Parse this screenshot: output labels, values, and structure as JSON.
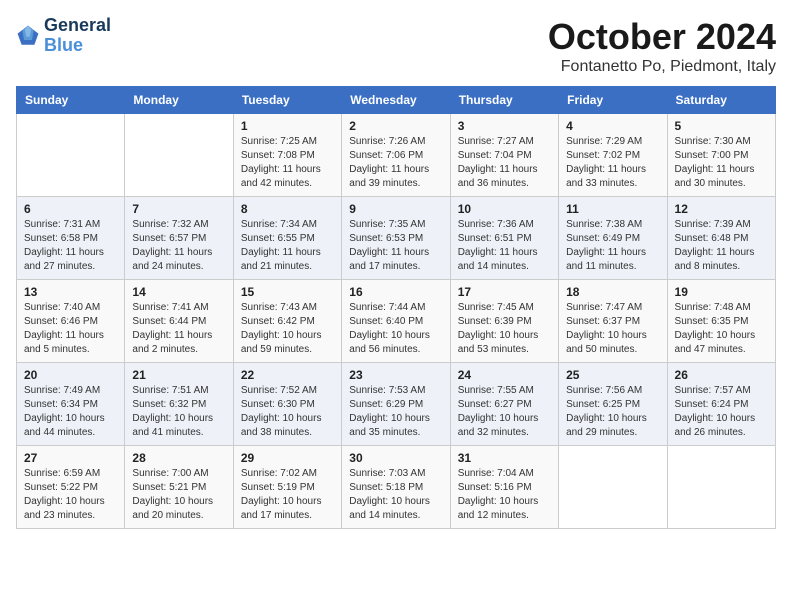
{
  "header": {
    "logo_line1": "General",
    "logo_line2": "Blue",
    "month": "October 2024",
    "location": "Fontanetto Po, Piedmont, Italy"
  },
  "weekdays": [
    "Sunday",
    "Monday",
    "Tuesday",
    "Wednesday",
    "Thursday",
    "Friday",
    "Saturday"
  ],
  "weeks": [
    [
      {
        "day": "",
        "sunrise": "",
        "sunset": "",
        "daylight": ""
      },
      {
        "day": "",
        "sunrise": "",
        "sunset": "",
        "daylight": ""
      },
      {
        "day": "1",
        "sunrise": "Sunrise: 7:25 AM",
        "sunset": "Sunset: 7:08 PM",
        "daylight": "Daylight: 11 hours and 42 minutes."
      },
      {
        "day": "2",
        "sunrise": "Sunrise: 7:26 AM",
        "sunset": "Sunset: 7:06 PM",
        "daylight": "Daylight: 11 hours and 39 minutes."
      },
      {
        "day": "3",
        "sunrise": "Sunrise: 7:27 AM",
        "sunset": "Sunset: 7:04 PM",
        "daylight": "Daylight: 11 hours and 36 minutes."
      },
      {
        "day": "4",
        "sunrise": "Sunrise: 7:29 AM",
        "sunset": "Sunset: 7:02 PM",
        "daylight": "Daylight: 11 hours and 33 minutes."
      },
      {
        "day": "5",
        "sunrise": "Sunrise: 7:30 AM",
        "sunset": "Sunset: 7:00 PM",
        "daylight": "Daylight: 11 hours and 30 minutes."
      }
    ],
    [
      {
        "day": "6",
        "sunrise": "Sunrise: 7:31 AM",
        "sunset": "Sunset: 6:58 PM",
        "daylight": "Daylight: 11 hours and 27 minutes."
      },
      {
        "day": "7",
        "sunrise": "Sunrise: 7:32 AM",
        "sunset": "Sunset: 6:57 PM",
        "daylight": "Daylight: 11 hours and 24 minutes."
      },
      {
        "day": "8",
        "sunrise": "Sunrise: 7:34 AM",
        "sunset": "Sunset: 6:55 PM",
        "daylight": "Daylight: 11 hours and 21 minutes."
      },
      {
        "day": "9",
        "sunrise": "Sunrise: 7:35 AM",
        "sunset": "Sunset: 6:53 PM",
        "daylight": "Daylight: 11 hours and 17 minutes."
      },
      {
        "day": "10",
        "sunrise": "Sunrise: 7:36 AM",
        "sunset": "Sunset: 6:51 PM",
        "daylight": "Daylight: 11 hours and 14 minutes."
      },
      {
        "day": "11",
        "sunrise": "Sunrise: 7:38 AM",
        "sunset": "Sunset: 6:49 PM",
        "daylight": "Daylight: 11 hours and 11 minutes."
      },
      {
        "day": "12",
        "sunrise": "Sunrise: 7:39 AM",
        "sunset": "Sunset: 6:48 PM",
        "daylight": "Daylight: 11 hours and 8 minutes."
      }
    ],
    [
      {
        "day": "13",
        "sunrise": "Sunrise: 7:40 AM",
        "sunset": "Sunset: 6:46 PM",
        "daylight": "Daylight: 11 hours and 5 minutes."
      },
      {
        "day": "14",
        "sunrise": "Sunrise: 7:41 AM",
        "sunset": "Sunset: 6:44 PM",
        "daylight": "Daylight: 11 hours and 2 minutes."
      },
      {
        "day": "15",
        "sunrise": "Sunrise: 7:43 AM",
        "sunset": "Sunset: 6:42 PM",
        "daylight": "Daylight: 10 hours and 59 minutes."
      },
      {
        "day": "16",
        "sunrise": "Sunrise: 7:44 AM",
        "sunset": "Sunset: 6:40 PM",
        "daylight": "Daylight: 10 hours and 56 minutes."
      },
      {
        "day": "17",
        "sunrise": "Sunrise: 7:45 AM",
        "sunset": "Sunset: 6:39 PM",
        "daylight": "Daylight: 10 hours and 53 minutes."
      },
      {
        "day": "18",
        "sunrise": "Sunrise: 7:47 AM",
        "sunset": "Sunset: 6:37 PM",
        "daylight": "Daylight: 10 hours and 50 minutes."
      },
      {
        "day": "19",
        "sunrise": "Sunrise: 7:48 AM",
        "sunset": "Sunset: 6:35 PM",
        "daylight": "Daylight: 10 hours and 47 minutes."
      }
    ],
    [
      {
        "day": "20",
        "sunrise": "Sunrise: 7:49 AM",
        "sunset": "Sunset: 6:34 PM",
        "daylight": "Daylight: 10 hours and 44 minutes."
      },
      {
        "day": "21",
        "sunrise": "Sunrise: 7:51 AM",
        "sunset": "Sunset: 6:32 PM",
        "daylight": "Daylight: 10 hours and 41 minutes."
      },
      {
        "day": "22",
        "sunrise": "Sunrise: 7:52 AM",
        "sunset": "Sunset: 6:30 PM",
        "daylight": "Daylight: 10 hours and 38 minutes."
      },
      {
        "day": "23",
        "sunrise": "Sunrise: 7:53 AM",
        "sunset": "Sunset: 6:29 PM",
        "daylight": "Daylight: 10 hours and 35 minutes."
      },
      {
        "day": "24",
        "sunrise": "Sunrise: 7:55 AM",
        "sunset": "Sunset: 6:27 PM",
        "daylight": "Daylight: 10 hours and 32 minutes."
      },
      {
        "day": "25",
        "sunrise": "Sunrise: 7:56 AM",
        "sunset": "Sunset: 6:25 PM",
        "daylight": "Daylight: 10 hours and 29 minutes."
      },
      {
        "day": "26",
        "sunrise": "Sunrise: 7:57 AM",
        "sunset": "Sunset: 6:24 PM",
        "daylight": "Daylight: 10 hours and 26 minutes."
      }
    ],
    [
      {
        "day": "27",
        "sunrise": "Sunrise: 6:59 AM",
        "sunset": "Sunset: 5:22 PM",
        "daylight": "Daylight: 10 hours and 23 minutes."
      },
      {
        "day": "28",
        "sunrise": "Sunrise: 7:00 AM",
        "sunset": "Sunset: 5:21 PM",
        "daylight": "Daylight: 10 hours and 20 minutes."
      },
      {
        "day": "29",
        "sunrise": "Sunrise: 7:02 AM",
        "sunset": "Sunset: 5:19 PM",
        "daylight": "Daylight: 10 hours and 17 minutes."
      },
      {
        "day": "30",
        "sunrise": "Sunrise: 7:03 AM",
        "sunset": "Sunset: 5:18 PM",
        "daylight": "Daylight: 10 hours and 14 minutes."
      },
      {
        "day": "31",
        "sunrise": "Sunrise: 7:04 AM",
        "sunset": "Sunset: 5:16 PM",
        "daylight": "Daylight: 10 hours and 12 minutes."
      },
      {
        "day": "",
        "sunrise": "",
        "sunset": "",
        "daylight": ""
      },
      {
        "day": "",
        "sunrise": "",
        "sunset": "",
        "daylight": ""
      }
    ]
  ]
}
